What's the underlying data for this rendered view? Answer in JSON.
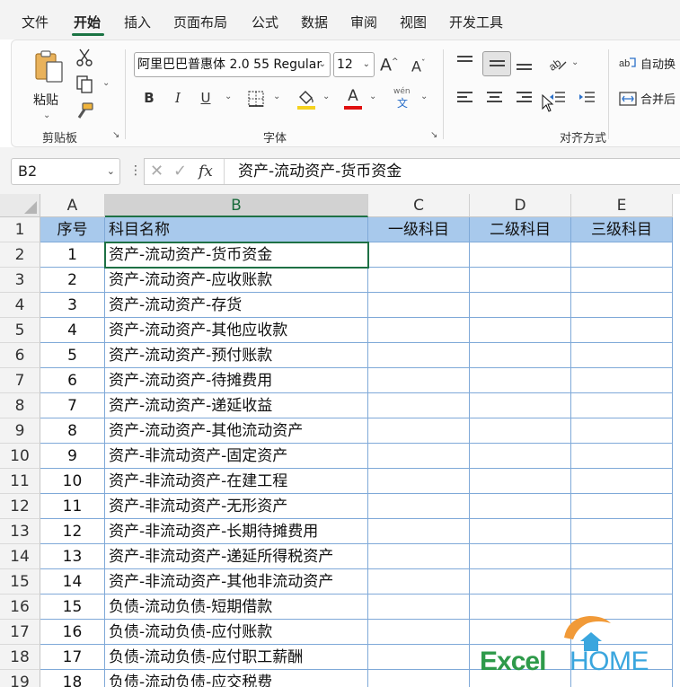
{
  "ribbon_tabs": [
    {
      "label": "文件",
      "active": false
    },
    {
      "label": "开始",
      "active": true
    },
    {
      "label": "插入",
      "active": false
    },
    {
      "label": "页面布局",
      "active": false
    },
    {
      "label": "公式",
      "active": false
    },
    {
      "label": "数据",
      "active": false
    },
    {
      "label": "审阅",
      "active": false
    },
    {
      "label": "视图",
      "active": false
    },
    {
      "label": "开发工具",
      "active": false
    }
  ],
  "clipboard": {
    "paste_label": "粘贴",
    "group_label": "剪贴板"
  },
  "font": {
    "name": "阿里巴巴普惠体 2.0 55 Regular",
    "size": "12",
    "bold": "B",
    "italic": "I",
    "underline": "U",
    "grow": "A",
    "shrink": "A",
    "font_color_glyph": "A",
    "phonetic_top": "wén",
    "phonetic_bottom": "文",
    "group_label": "字体",
    "fill_color": "#f5d21f",
    "text_color": "#e01010"
  },
  "alignment": {
    "wrap_label": "自动换",
    "merge_label": "合并后",
    "group_label": "对齐方式"
  },
  "formula_bar": {
    "name_box": "B2",
    "fx": "fx",
    "content": "资产-流动资产-货币资金"
  },
  "columns": [
    "A",
    "B",
    "C",
    "D",
    "E"
  ],
  "selected_column": "B",
  "header_row": {
    "row_num": "1",
    "a": "序号",
    "b": "科目名称",
    "c": "一级科目",
    "d": "二级科目",
    "e": "三级科目"
  },
  "rows": [
    {
      "row_num": "2",
      "a": "1",
      "b": "资产-流动资产-货币资金"
    },
    {
      "row_num": "3",
      "a": "2",
      "b": "资产-流动资产-应收账款"
    },
    {
      "row_num": "4",
      "a": "3",
      "b": "资产-流动资产-存货"
    },
    {
      "row_num": "5",
      "a": "4",
      "b": "资产-流动资产-其他应收款"
    },
    {
      "row_num": "6",
      "a": "5",
      "b": "资产-流动资产-预付账款"
    },
    {
      "row_num": "7",
      "a": "6",
      "b": "资产-流动资产-待摊费用"
    },
    {
      "row_num": "8",
      "a": "7",
      "b": "资产-流动资产-递延收益"
    },
    {
      "row_num": "9",
      "a": "8",
      "b": "资产-流动资产-其他流动资产"
    },
    {
      "row_num": "10",
      "a": "9",
      "b": "资产-非流动资产-固定资产"
    },
    {
      "row_num": "11",
      "a": "10",
      "b": "资产-非流动资产-在建工程"
    },
    {
      "row_num": "12",
      "a": "11",
      "b": "资产-非流动资产-无形资产"
    },
    {
      "row_num": "13",
      "a": "12",
      "b": "资产-非流动资产-长期待摊费用"
    },
    {
      "row_num": "14",
      "a": "13",
      "b": "资产-非流动资产-递延所得税资产"
    },
    {
      "row_num": "15",
      "a": "14",
      "b": "资产-非流动资产-其他非流动资产"
    },
    {
      "row_num": "16",
      "a": "15",
      "b": "负债-流动负债-短期借款"
    },
    {
      "row_num": "17",
      "a": "16",
      "b": "负债-流动负债-应付账款"
    },
    {
      "row_num": "18",
      "a": "17",
      "b": "负债-流动负债-应付职工薪酬"
    },
    {
      "row_num": "19",
      "a": "18",
      "b": "负债-流动负债-应交税费"
    }
  ],
  "watermark": {
    "left": "Excel",
    "right": "HOME"
  },
  "colors": {
    "accent_green": "#1e7145",
    "header_fill": "#a8c9ec",
    "grid_line": "#7fa9d8"
  }
}
